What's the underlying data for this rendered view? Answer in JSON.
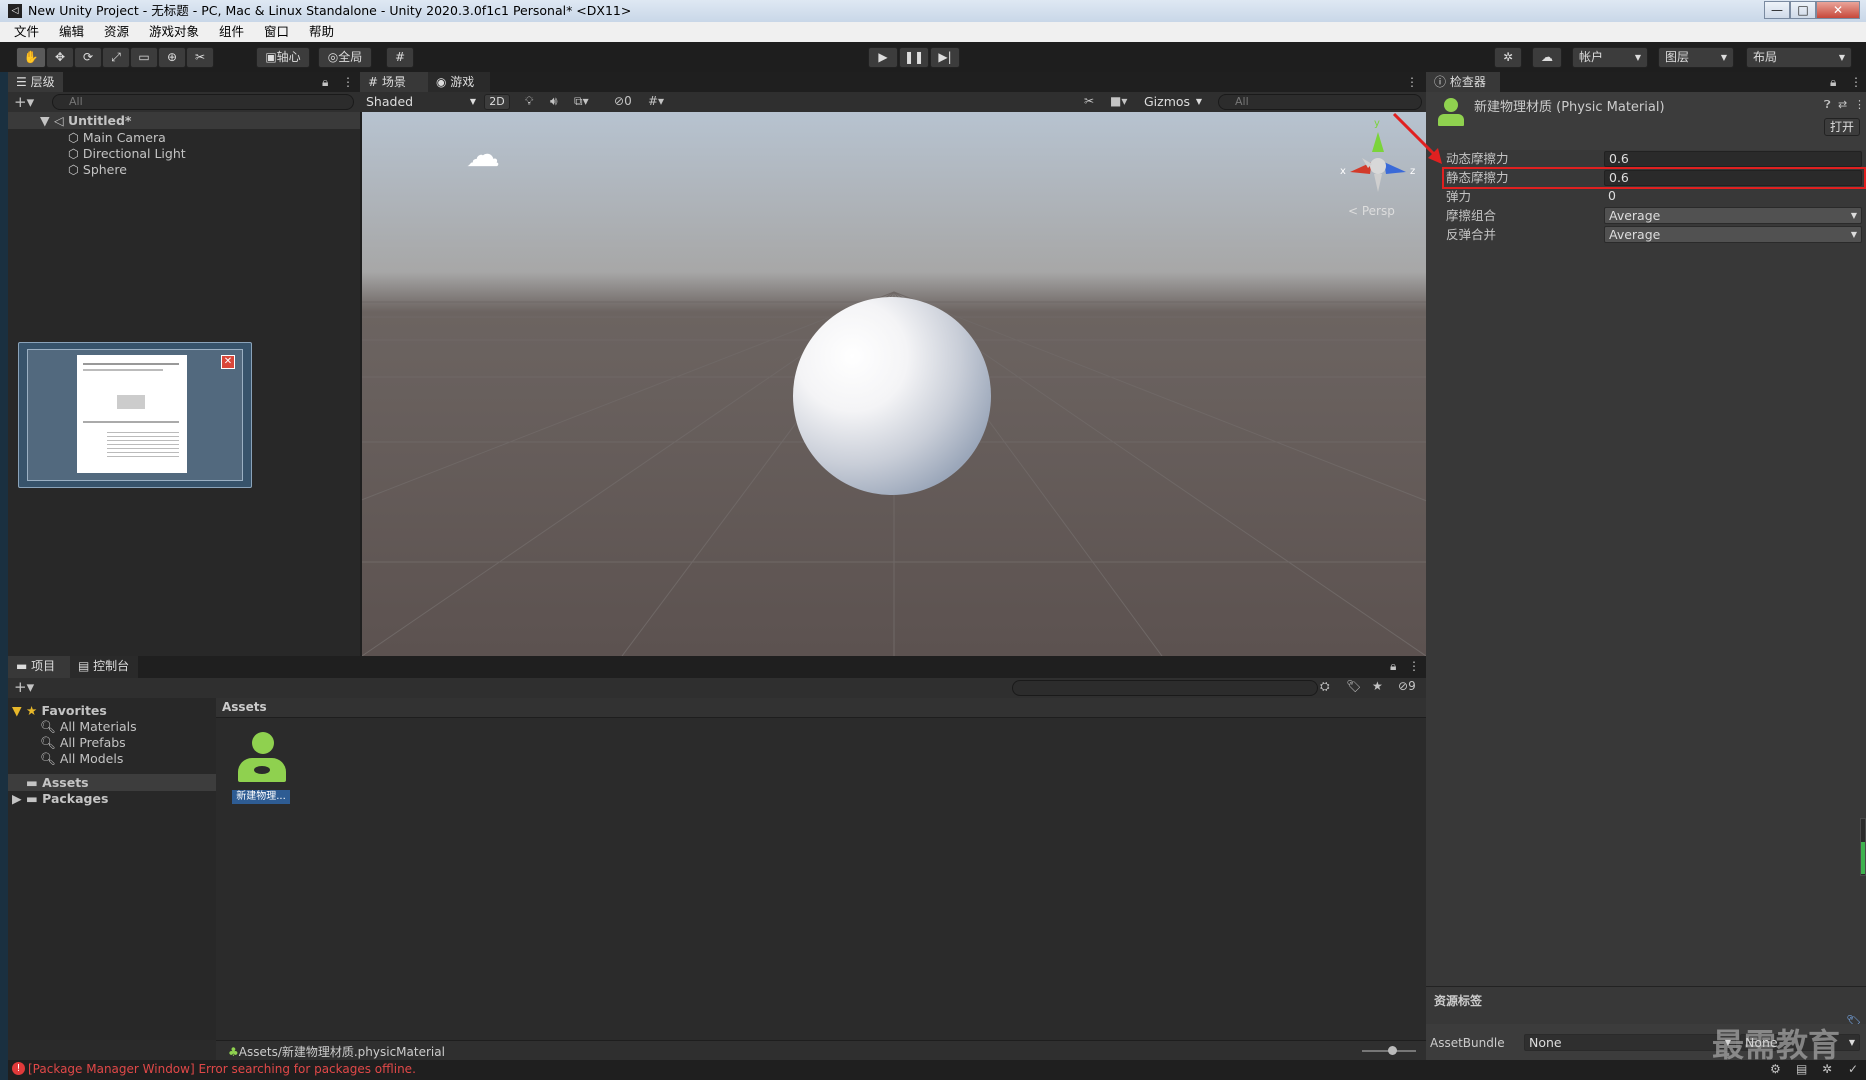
{
  "window": {
    "title": "New Unity Project - 无标题 - PC, Mac & Linux Standalone - Unity 2020.3.0f1c1 Personal* <DX11>",
    "minimize": "—",
    "maximize": "□",
    "close": "✕"
  },
  "menu": [
    "文件",
    "编辑",
    "资源",
    "游戏对象",
    "组件",
    "窗口",
    "帮助"
  ],
  "toolbar": {
    "pivot_label": "轴心",
    "global_label": "全局",
    "account_label": "帐户",
    "layers_label": "图层",
    "layout_label": "布局"
  },
  "hierarchy": {
    "tab_label": "层级",
    "search_placeholder": "All",
    "scene_name": "Untitled*",
    "items": [
      "Main Camera",
      "Directional Light",
      "Sphere"
    ]
  },
  "scene": {
    "tab_scene": "场景",
    "tab_game": "游戏",
    "shading_mode": "Shaded",
    "mode_2d": "2D",
    "hidden_count": "0",
    "gizmos_label": "Gizmos",
    "search_placeholder": "All",
    "persp_label": "< Persp",
    "axis_x": "x",
    "axis_y": "y",
    "axis_z": "z"
  },
  "inspector": {
    "tab_label": "检查器",
    "object_title": "新建物理材质 (Physic Material)",
    "open_button": "打开",
    "properties": [
      {
        "label": "动态摩擦力",
        "value": "0.6"
      },
      {
        "label": "静态摩擦力",
        "value": "0.6"
      },
      {
        "label": "弹力",
        "value": "0"
      },
      {
        "label": "摩擦组合",
        "value": "Average"
      },
      {
        "label": "反弹合并",
        "value": "Average"
      }
    ],
    "asset_labels_title": "资源标签",
    "assetbundle_label": "AssetBundle",
    "assetbundle_value": "None",
    "assetbundle_variant": "None",
    "highlight_color": "#e02020"
  },
  "project": {
    "tab_project": "项目",
    "tab_console": "控制台",
    "favorites_label": "Favorites",
    "favorites": [
      "All Materials",
      "All Prefabs",
      "All Models"
    ],
    "folders": [
      "Assets",
      "Packages"
    ],
    "breadcrumb": "Assets",
    "asset_name": "新建物理...",
    "hidden_count": "9",
    "status_path": "Assets/新建物理材质.physicMaterial"
  },
  "status_bar": {
    "error": "[Package Manager Window] Error searching for packages offline."
  },
  "watermark": "最需教育"
}
